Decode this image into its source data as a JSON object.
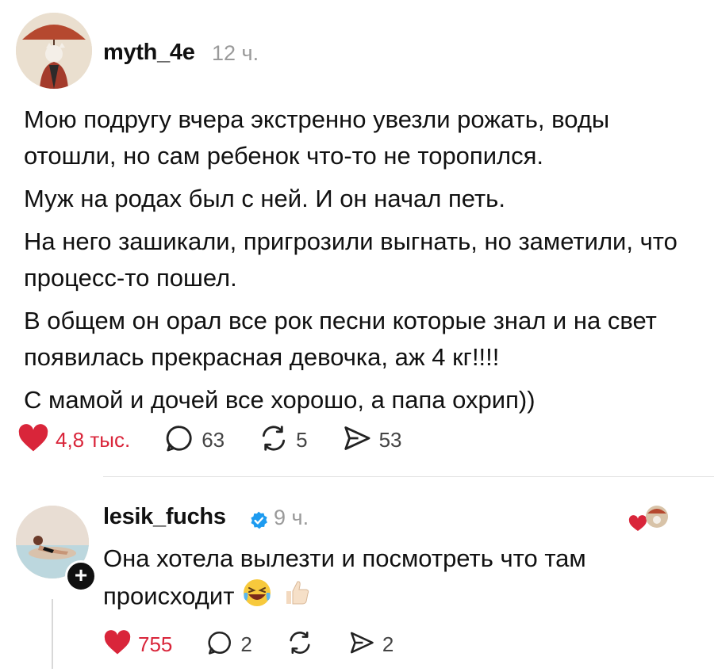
{
  "post": {
    "username": "myth_4e",
    "time": "12 ч.",
    "paragraphs": [
      "Мою подругу вчера экстренно увезли рожать, воды отошли, но сам ребенок что-то не торопился.",
      "Муж на родах был с ней. И он начал петь.",
      "На него зашикали, пригрозили выгнать, но заметили, что процесс-то пошел.",
      "В общем он орал все рок песни которые знал и на свет появилась прекрасная девочка, аж 4 кг!!!!",
      "С мамой и дочей все хорошо, а папа охрип))"
    ],
    "likes": "4,8 тыс.",
    "comments": "63",
    "reposts": "5",
    "shares": "53"
  },
  "reply": {
    "username": "lesik_fuchs",
    "time": "9 ч.",
    "text": "Она хотела вылезти и посмотреть что там происходит",
    "follow_symbol": "+",
    "likes": "755",
    "comments": "2",
    "reposts": "",
    "shares": "2"
  },
  "colors": {
    "like_red": "#d9253a",
    "verified_blue": "#1d9bf0",
    "muted_gray": "#9a9a9a"
  },
  "icons": [
    "heart-icon",
    "comment-icon",
    "repost-icon",
    "share-icon",
    "verified-icon",
    "laughing-emoji-icon",
    "thumbs-up-emoji-icon"
  ]
}
